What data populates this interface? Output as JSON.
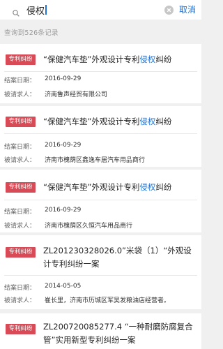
{
  "search": {
    "value": "侵权",
    "cancel_label": "取消"
  },
  "result_count": "查询到526条记录",
  "labels": {
    "date": "结案日期：",
    "party": "被请求人："
  },
  "cards": [
    {
      "badge": "专利纠纷",
      "title_before": "“保健汽车垫”外观设计专利",
      "title_highlight": "侵权",
      "title_after": "纠纷",
      "date": "2016-09-29",
      "party": "济南鲁声经贸有限公司"
    },
    {
      "badge": "专利纠纷",
      "title_before": "“保健汽车垫”外观设计专利",
      "title_highlight": "侵权",
      "title_after": "纠纷",
      "date": "2016-09-29",
      "party": "济南市槐荫区鑫逸车居汽车用品商行"
    },
    {
      "badge": "专利纠纷",
      "title_before": "“保健汽车垫”外观设计专利",
      "title_highlight": "侵权",
      "title_after": "纠纷",
      "date": "2016-09-29",
      "party": "济南市槐荫区久恒汽车用品商行"
    },
    {
      "badge": "专利纠纷",
      "title_before": "ZL201230328026.0”米袋（1）“外观设计专利纠纷一案",
      "title_highlight": "",
      "title_after": "",
      "date": "2014-05-05",
      "party": "崔长里，济南市历城区军吴发粮油店经营者。"
    },
    {
      "badge": "专利纠纷",
      "title_before": "ZL200720085277.4 “一种耐磨防腐复合管”实用新型专利纠纷一案",
      "title_highlight": "",
      "title_after": "",
      "date": "",
      "party": ""
    }
  ],
  "colors": {
    "accent": "#1e73d6",
    "badge": "#d84b56",
    "background": "#f0f0f0"
  }
}
